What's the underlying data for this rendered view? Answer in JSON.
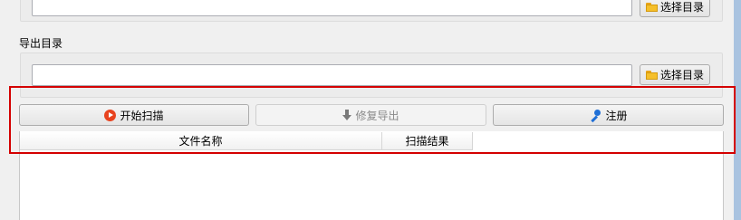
{
  "top_section": {
    "browse_button_label": "选择目录",
    "path_value": ""
  },
  "export_section": {
    "label": "导出目录",
    "path_value": "",
    "browse_button_label": "选择目录"
  },
  "actions": {
    "start_scan_label": "开始扫描",
    "repair_export_label": "修复导出",
    "register_label": "注册"
  },
  "results_table": {
    "columns": [
      "文件名称",
      "扫描结果"
    ],
    "rows": []
  },
  "colors": {
    "highlight_frame": "#d40000",
    "play_icon": "#e8431f",
    "key_icon": "#1f6fd6",
    "folder_icon": "#f5bf2a"
  }
}
